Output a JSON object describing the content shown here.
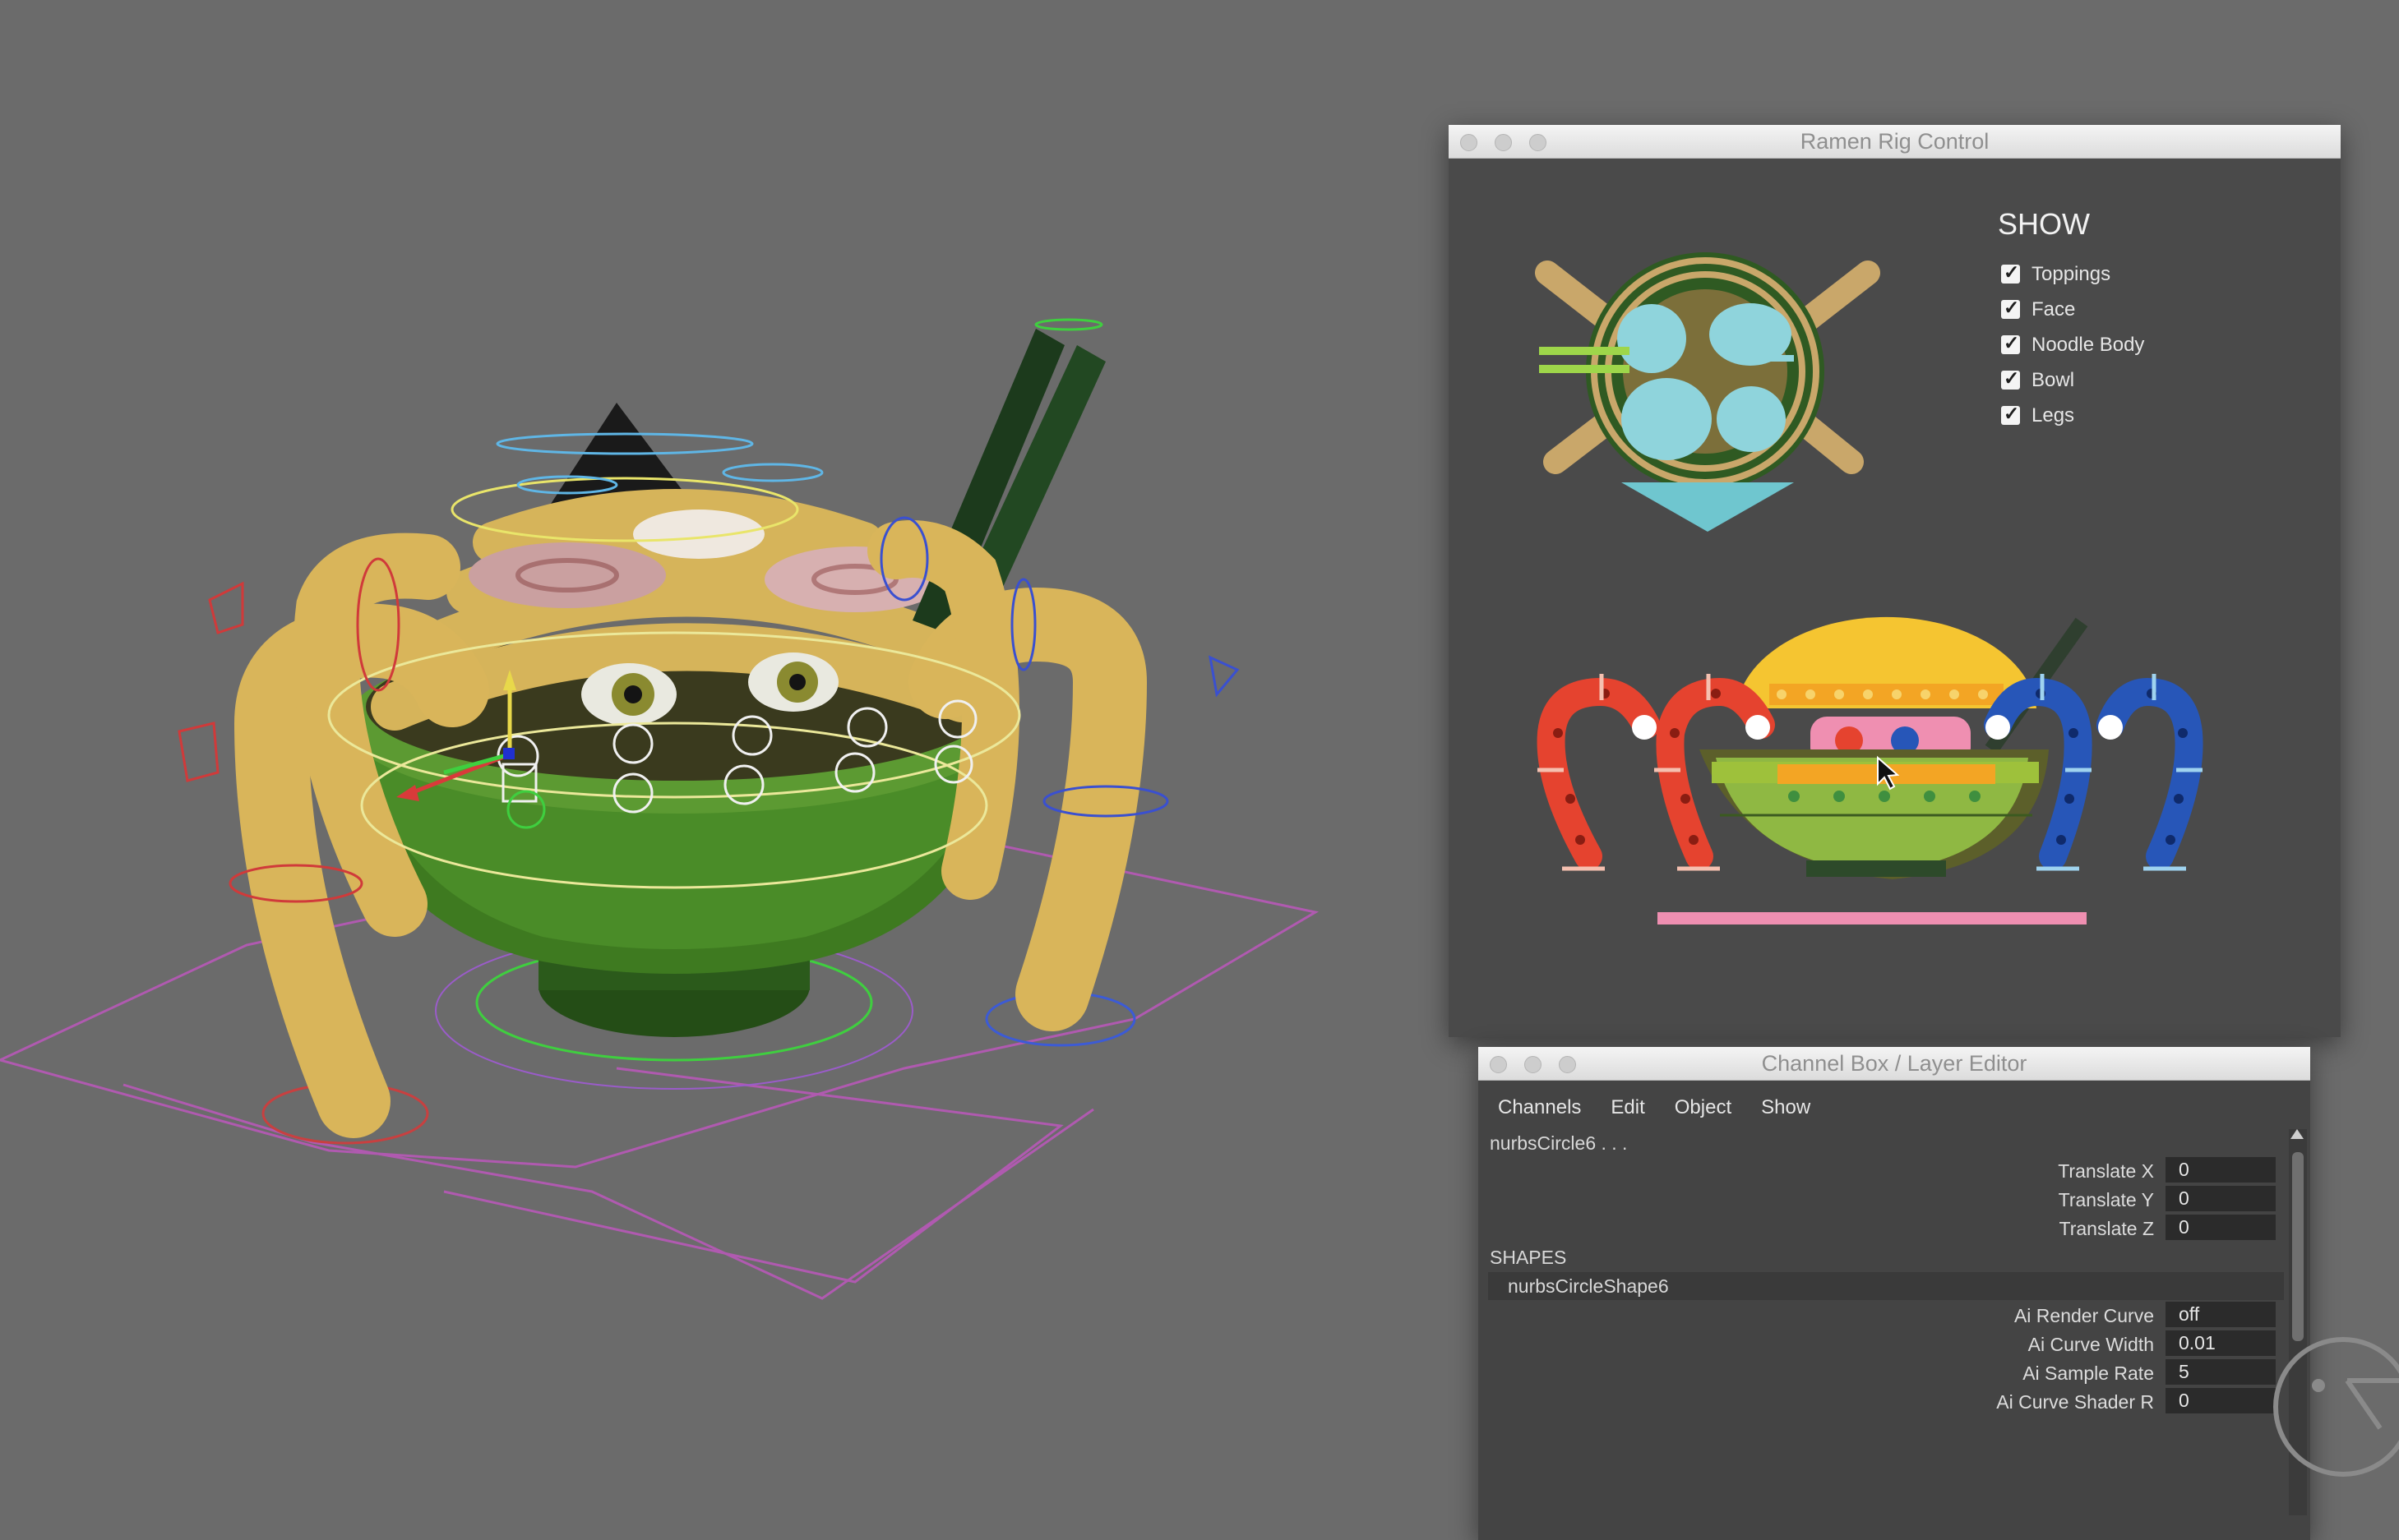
{
  "rig_window": {
    "title": "Ramen Rig Control",
    "show_heading": "SHOW",
    "show_options": [
      {
        "label": "Toppings",
        "checked": true
      },
      {
        "label": "Face",
        "checked": true
      },
      {
        "label": "Noodle Body",
        "checked": true
      },
      {
        "label": "Bowl",
        "checked": true
      },
      {
        "label": "Legs",
        "checked": true
      }
    ]
  },
  "channel_box": {
    "title": "Channel Box / Layer Editor",
    "menu": [
      "Channels",
      "Edit",
      "Object",
      "Show"
    ],
    "node_name": "nurbsCircle6 . . .",
    "transform_attrs": [
      {
        "label": "Translate X",
        "value": "0"
      },
      {
        "label": "Translate Y",
        "value": "0"
      },
      {
        "label": "Translate Z",
        "value": "0"
      }
    ],
    "shapes_heading": "SHAPES",
    "shape_name": "nurbsCircleShape6",
    "shape_attrs": [
      {
        "label": "Ai Render Curve",
        "value": "off"
      },
      {
        "label": "Ai Curve Width",
        "value": "0.01"
      },
      {
        "label": "Ai Sample Rate",
        "value": "5"
      },
      {
        "label": "Ai Curve Shader R",
        "value": "0"
      }
    ]
  },
  "colors": {
    "viewport_bg": "#6b6b6b",
    "panel_bg": "#4a4a4a",
    "leg_left": "#e5432f",
    "leg_right": "#2756b8",
    "bowl_green": "#8fb843",
    "noodle_yellow": "#f5c531",
    "topping_pink": "#ef8fb1"
  }
}
